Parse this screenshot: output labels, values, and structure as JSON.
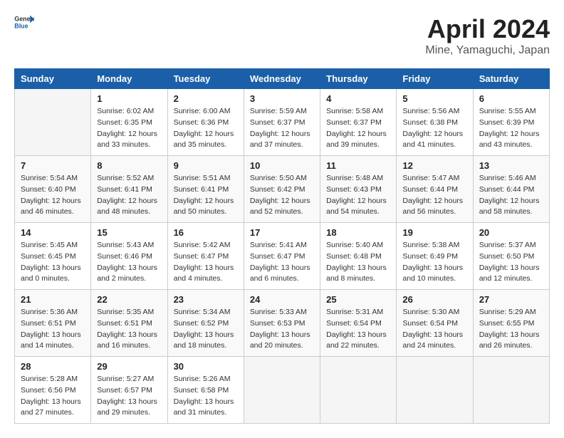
{
  "header": {
    "logo_general": "General",
    "logo_blue": "Blue",
    "title": "April 2024",
    "subtitle": "Mine, Yamaguchi, Japan"
  },
  "calendar": {
    "days_of_week": [
      "Sunday",
      "Monday",
      "Tuesday",
      "Wednesday",
      "Thursday",
      "Friday",
      "Saturday"
    ],
    "weeks": [
      [
        {
          "day": "",
          "info": ""
        },
        {
          "day": "1",
          "info": "Sunrise: 6:02 AM\nSunset: 6:35 PM\nDaylight: 12 hours\nand 33 minutes."
        },
        {
          "day": "2",
          "info": "Sunrise: 6:00 AM\nSunset: 6:36 PM\nDaylight: 12 hours\nand 35 minutes."
        },
        {
          "day": "3",
          "info": "Sunrise: 5:59 AM\nSunset: 6:37 PM\nDaylight: 12 hours\nand 37 minutes."
        },
        {
          "day": "4",
          "info": "Sunrise: 5:58 AM\nSunset: 6:37 PM\nDaylight: 12 hours\nand 39 minutes."
        },
        {
          "day": "5",
          "info": "Sunrise: 5:56 AM\nSunset: 6:38 PM\nDaylight: 12 hours\nand 41 minutes."
        },
        {
          "day": "6",
          "info": "Sunrise: 5:55 AM\nSunset: 6:39 PM\nDaylight: 12 hours\nand 43 minutes."
        }
      ],
      [
        {
          "day": "7",
          "info": "Sunrise: 5:54 AM\nSunset: 6:40 PM\nDaylight: 12 hours\nand 46 minutes."
        },
        {
          "day": "8",
          "info": "Sunrise: 5:52 AM\nSunset: 6:41 PM\nDaylight: 12 hours\nand 48 minutes."
        },
        {
          "day": "9",
          "info": "Sunrise: 5:51 AM\nSunset: 6:41 PM\nDaylight: 12 hours\nand 50 minutes."
        },
        {
          "day": "10",
          "info": "Sunrise: 5:50 AM\nSunset: 6:42 PM\nDaylight: 12 hours\nand 52 minutes."
        },
        {
          "day": "11",
          "info": "Sunrise: 5:48 AM\nSunset: 6:43 PM\nDaylight: 12 hours\nand 54 minutes."
        },
        {
          "day": "12",
          "info": "Sunrise: 5:47 AM\nSunset: 6:44 PM\nDaylight: 12 hours\nand 56 minutes."
        },
        {
          "day": "13",
          "info": "Sunrise: 5:46 AM\nSunset: 6:44 PM\nDaylight: 12 hours\nand 58 minutes."
        }
      ],
      [
        {
          "day": "14",
          "info": "Sunrise: 5:45 AM\nSunset: 6:45 PM\nDaylight: 13 hours\nand 0 minutes."
        },
        {
          "day": "15",
          "info": "Sunrise: 5:43 AM\nSunset: 6:46 PM\nDaylight: 13 hours\nand 2 minutes."
        },
        {
          "day": "16",
          "info": "Sunrise: 5:42 AM\nSunset: 6:47 PM\nDaylight: 13 hours\nand 4 minutes."
        },
        {
          "day": "17",
          "info": "Sunrise: 5:41 AM\nSunset: 6:47 PM\nDaylight: 13 hours\nand 6 minutes."
        },
        {
          "day": "18",
          "info": "Sunrise: 5:40 AM\nSunset: 6:48 PM\nDaylight: 13 hours\nand 8 minutes."
        },
        {
          "day": "19",
          "info": "Sunrise: 5:38 AM\nSunset: 6:49 PM\nDaylight: 13 hours\nand 10 minutes."
        },
        {
          "day": "20",
          "info": "Sunrise: 5:37 AM\nSunset: 6:50 PM\nDaylight: 13 hours\nand 12 minutes."
        }
      ],
      [
        {
          "day": "21",
          "info": "Sunrise: 5:36 AM\nSunset: 6:51 PM\nDaylight: 13 hours\nand 14 minutes."
        },
        {
          "day": "22",
          "info": "Sunrise: 5:35 AM\nSunset: 6:51 PM\nDaylight: 13 hours\nand 16 minutes."
        },
        {
          "day": "23",
          "info": "Sunrise: 5:34 AM\nSunset: 6:52 PM\nDaylight: 13 hours\nand 18 minutes."
        },
        {
          "day": "24",
          "info": "Sunrise: 5:33 AM\nSunset: 6:53 PM\nDaylight: 13 hours\nand 20 minutes."
        },
        {
          "day": "25",
          "info": "Sunrise: 5:31 AM\nSunset: 6:54 PM\nDaylight: 13 hours\nand 22 minutes."
        },
        {
          "day": "26",
          "info": "Sunrise: 5:30 AM\nSunset: 6:54 PM\nDaylight: 13 hours\nand 24 minutes."
        },
        {
          "day": "27",
          "info": "Sunrise: 5:29 AM\nSunset: 6:55 PM\nDaylight: 13 hours\nand 26 minutes."
        }
      ],
      [
        {
          "day": "28",
          "info": "Sunrise: 5:28 AM\nSunset: 6:56 PM\nDaylight: 13 hours\nand 27 minutes."
        },
        {
          "day": "29",
          "info": "Sunrise: 5:27 AM\nSunset: 6:57 PM\nDaylight: 13 hours\nand 29 minutes."
        },
        {
          "day": "30",
          "info": "Sunrise: 5:26 AM\nSunset: 6:58 PM\nDaylight: 13 hours\nand 31 minutes."
        },
        {
          "day": "",
          "info": ""
        },
        {
          "day": "",
          "info": ""
        },
        {
          "day": "",
          "info": ""
        },
        {
          "day": "",
          "info": ""
        }
      ]
    ]
  }
}
